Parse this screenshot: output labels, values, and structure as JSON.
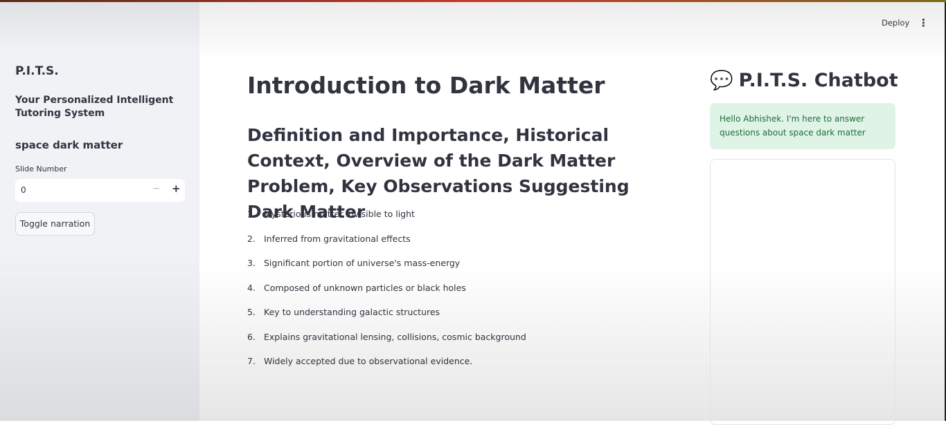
{
  "header": {
    "deploy_label": "Deploy",
    "menu_icon": "kebab-menu-icon"
  },
  "sidebar": {
    "title": "P.I.T.S.",
    "subtitle": "Your Personalized Intelligent Tutoring System",
    "topic": "space dark matter",
    "slide_label": "Slide Number",
    "slide_value": "0",
    "minus": "−",
    "plus": "+",
    "toggle_label": "Toggle narration"
  },
  "main": {
    "title": "Introduction to Dark Matter",
    "subtitle": "Definition and Importance, Historical Context, Overview of the Dark Matter Problem, Key Observations Suggesting Dark Matter",
    "items": [
      {
        "n": "1.",
        "text": "Mysterious matter invisible to light"
      },
      {
        "n": "2.",
        "text": "Inferred from gravitational effects"
      },
      {
        "n": "3.",
        "text": "Significant portion of universe's mass-energy"
      },
      {
        "n": "4.",
        "text": "Composed of unknown particles or black holes"
      },
      {
        "n": "5.",
        "text": "Key to understanding galactic structures"
      },
      {
        "n": "6.",
        "text": "Explains gravitational lensing, collisions, cosmic background"
      },
      {
        "n": "7.",
        "text": "Widely accepted due to observational evidence."
      }
    ]
  },
  "chat": {
    "icon": "💬",
    "title": "P.I.T.S. Chatbot",
    "message": "Hello Abhishek. I'm here to answer questions about space dark matter"
  }
}
